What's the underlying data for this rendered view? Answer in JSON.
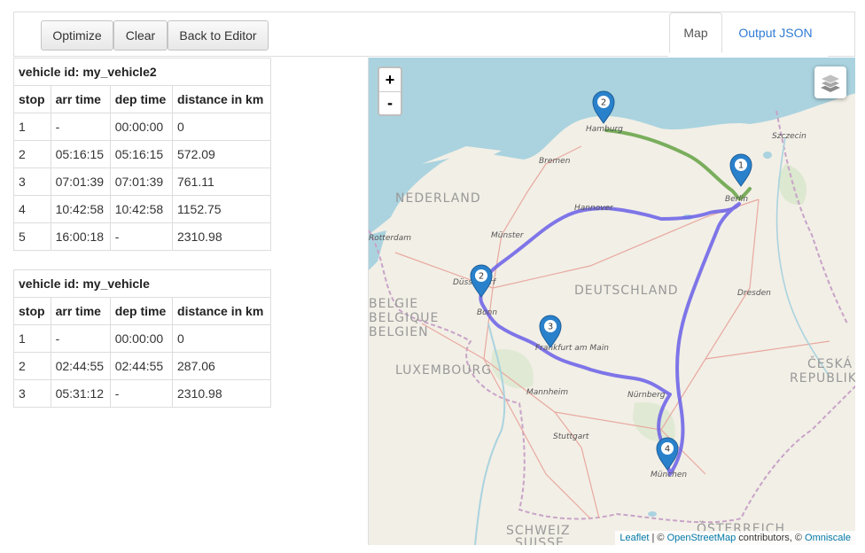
{
  "toolbar": {
    "optimize_label": "Optimize",
    "clear_label": "Clear",
    "back_label": "Back to Editor"
  },
  "tabs": [
    {
      "label": "Map",
      "active": true
    },
    {
      "label": "Output JSON",
      "active": false
    }
  ],
  "vehicles": [
    {
      "title": "vehicle id: my_vehicle2",
      "headers": [
        "stop",
        "arr time",
        "dep time",
        "distance in km"
      ],
      "rows": [
        [
          "1",
          "-",
          "00:00:00",
          "0"
        ],
        [
          "2",
          "05:16:15",
          "05:16:15",
          "572.09"
        ],
        [
          "3",
          "07:01:39",
          "07:01:39",
          "761.11"
        ],
        [
          "4",
          "10:42:58",
          "10:42:58",
          "1152.75"
        ],
        [
          "5",
          "16:00:18",
          "-",
          "2310.98"
        ]
      ]
    },
    {
      "title": "vehicle id: my_vehicle",
      "headers": [
        "stop",
        "arr time",
        "dep time",
        "distance in km"
      ],
      "rows": [
        [
          "1",
          "-",
          "00:00:00",
          "0"
        ],
        [
          "2",
          "02:44:55",
          "02:44:55",
          "287.06"
        ],
        [
          "3",
          "05:31:12",
          "-",
          "2310.98"
        ]
      ]
    }
  ],
  "map": {
    "zoom_in": "+",
    "zoom_out": "-",
    "layers_icon": "layers-icon",
    "route_colors": {
      "vehicle2": "#6a5fe8",
      "vehicle": "#5a9e3a"
    },
    "markers": [
      {
        "number": "1",
        "city": "Berlin"
      },
      {
        "number": "2",
        "city": "Hamburg"
      },
      {
        "number": "2",
        "city": "Düsseldorf"
      },
      {
        "number": "3",
        "city": "Frankfurt am Main"
      },
      {
        "number": "4",
        "city": "München"
      }
    ],
    "cities": [
      "Hamburg",
      "Szczecin",
      "Bremen",
      "Berlin",
      "Hannover",
      "Münster",
      "Dresden",
      "Bonn",
      "Frankfurt am Main",
      "Mannheim",
      "Nürnberg",
      "Stuttgart",
      "München",
      "Rotterdam",
      "Düsseldorf"
    ],
    "countries": [
      "NEDERLAND",
      "DEUTSCHLAND",
      "BELGIE",
      "BELGIQUE",
      "BELGIEN",
      "LUXEMBOURG",
      "ČESKÁ",
      "REPUBLIKA",
      "SCHWEIZ",
      "SUISSE",
      "ÖSTERREICH"
    ],
    "attribution": {
      "leaflet": "Leaflet",
      "sep1": " | © ",
      "osm": "OpenStreetMap",
      "sep2": " contributors, © ",
      "omniscale": "Omniscale"
    }
  }
}
